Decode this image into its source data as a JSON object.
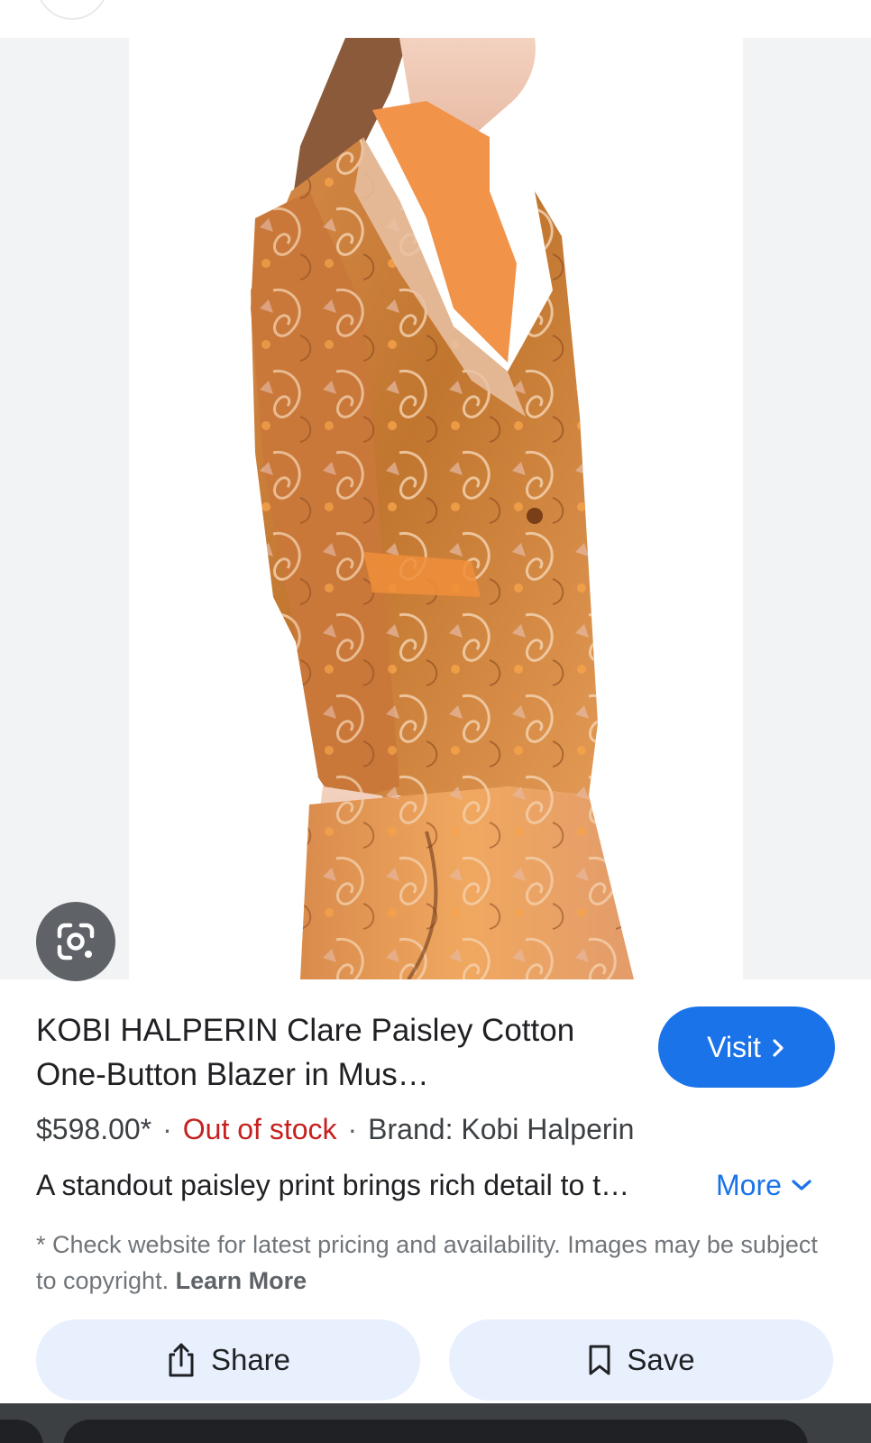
{
  "product": {
    "title": "KOBI HALPERIN Clare Paisley Cotton One-Button Blazer in Mus…",
    "price": "$598.00*",
    "availability": "Out of stock",
    "brand": "Brand: Kobi Halperin",
    "description": "A standout paisley print brings rich detail to t…",
    "separator": "·"
  },
  "actions": {
    "visit_label": "Visit",
    "more_label": "More",
    "share_label": "Share",
    "save_label": "Save"
  },
  "disclaimer": {
    "text": "* Check website for latest pricing and availability. Images may be subject to copyright.",
    "learn_more": "Learn More"
  },
  "icons": {
    "lens": "google-lens-icon",
    "visit": "chevron-right-icon",
    "more": "chevron-down-icon",
    "share": "share-icon",
    "save": "bookmark-icon"
  },
  "colors": {
    "accent": "#1a73e8",
    "out_of_stock": "#c5221f",
    "action_button_bg": "#e8f0fe",
    "lens_button_bg": "#5f6368"
  }
}
